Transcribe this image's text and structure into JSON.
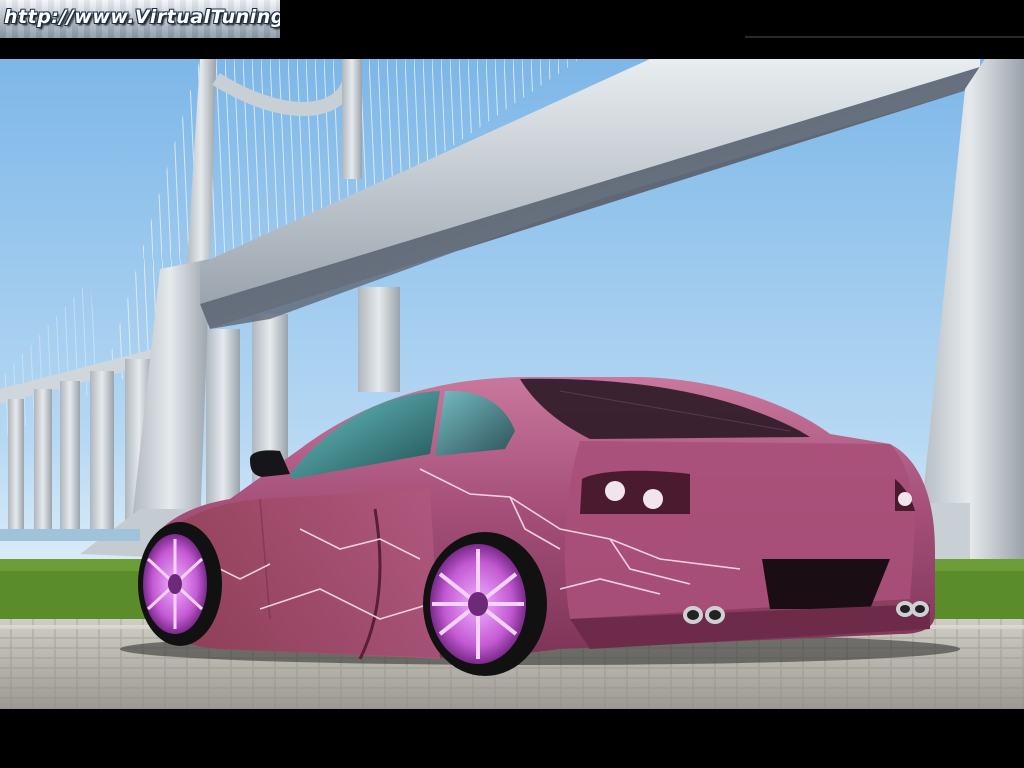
{
  "watermark": {
    "text": "http://www.VirtualTuning.IT"
  },
  "scene": {
    "colors": {
      "sky": "#8fc3ec",
      "sky_light": "#d9ecf9",
      "bridge": "#d5dce2",
      "bridge_shadow": "#6b7480",
      "grass": "#5a8a2a",
      "pavement": "#b9b7ae",
      "car_body": "#a04a6e",
      "car_highlight": "#c86a93",
      "wheel": "#c85ad8",
      "lightning": "#ffe0f0"
    }
  }
}
